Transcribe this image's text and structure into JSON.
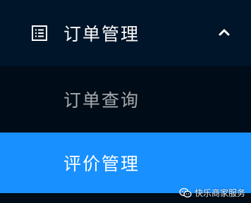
{
  "menu": {
    "title": "订单管理",
    "icon": "list-icon",
    "expanded_icon": "chevron-up-icon",
    "items": [
      {
        "label": "订单查询",
        "active": false
      },
      {
        "label": "评价管理",
        "active": true
      }
    ]
  },
  "watermark": {
    "text": "快乐商家服务",
    "icon": "wechat-icon"
  },
  "colors": {
    "sidebar_bg": "#001529",
    "submenu_bg": "#000c17",
    "active_bg": "#1890ff",
    "text_primary": "#ffffff",
    "text_muted": "rgba(255,255,255,0.65)"
  }
}
